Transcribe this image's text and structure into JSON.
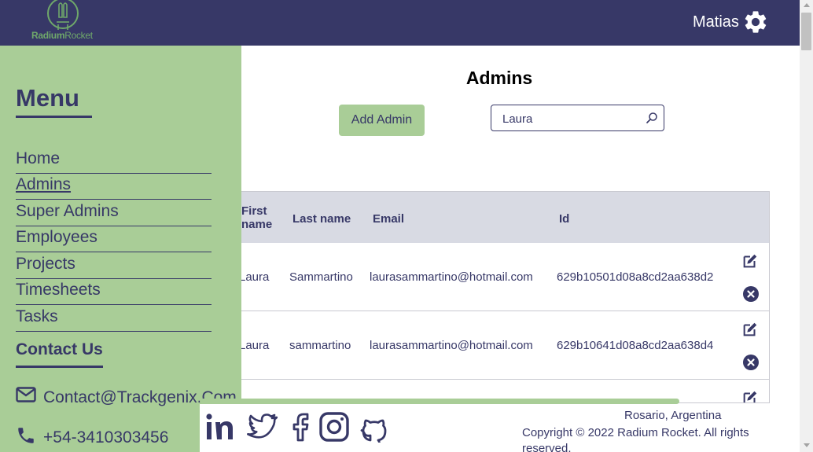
{
  "header": {
    "logo_text_bold": "Radium",
    "logo_text_light": "Rocket",
    "user_name": "Matias",
    "settings_icon": "gear-icon"
  },
  "main": {
    "title": "Admins",
    "add_button_label": "Add Admin",
    "search_value": "Laura",
    "search_icon": "search-icon"
  },
  "table": {
    "headers": [
      "First name",
      "Last name",
      "Email",
      "Id"
    ],
    "header_first_line1": "First",
    "header_first_line2": "name",
    "rows": [
      {
        "first_name": "Laura",
        "last_name": "Sammartino",
        "email": "laurasammartino@hotmail.com",
        "id": "629b10501d08a8cd2aa638d2"
      },
      {
        "first_name": "Laura",
        "last_name": "sammartino",
        "email": "laurasammartino@hotmail.com",
        "id": "629b10641d08a8cd2aa638d4"
      },
      {
        "first_name": "",
        "last_name": "",
        "email": "",
        "id": ""
      }
    ]
  },
  "sidebar": {
    "menu_title": "Menu",
    "items": [
      {
        "label": "Home",
        "active": false
      },
      {
        "label": "Admins",
        "active": true
      },
      {
        "label": "Super Admins",
        "active": false
      },
      {
        "label": "Employees",
        "active": false
      },
      {
        "label": "Projects",
        "active": false
      },
      {
        "label": "Timesheets",
        "active": false
      },
      {
        "label": "Tasks",
        "active": false
      }
    ],
    "contact_title": "Contact Us",
    "contact_email": "Contact@Trackgenix.Com",
    "contact_phone": "+54-3410303456"
  },
  "footer": {
    "social": [
      "linkedin-icon",
      "twitter-icon",
      "facebook-icon",
      "instagram-icon",
      "github-icon"
    ],
    "location": "Rosario, Argentina",
    "copyright": "Copyright © 2022 Radium Rocket. All rights reserved."
  },
  "colors": {
    "primary": "#373867",
    "accent": "#a9cd97",
    "table_header": "#d8dae3"
  }
}
